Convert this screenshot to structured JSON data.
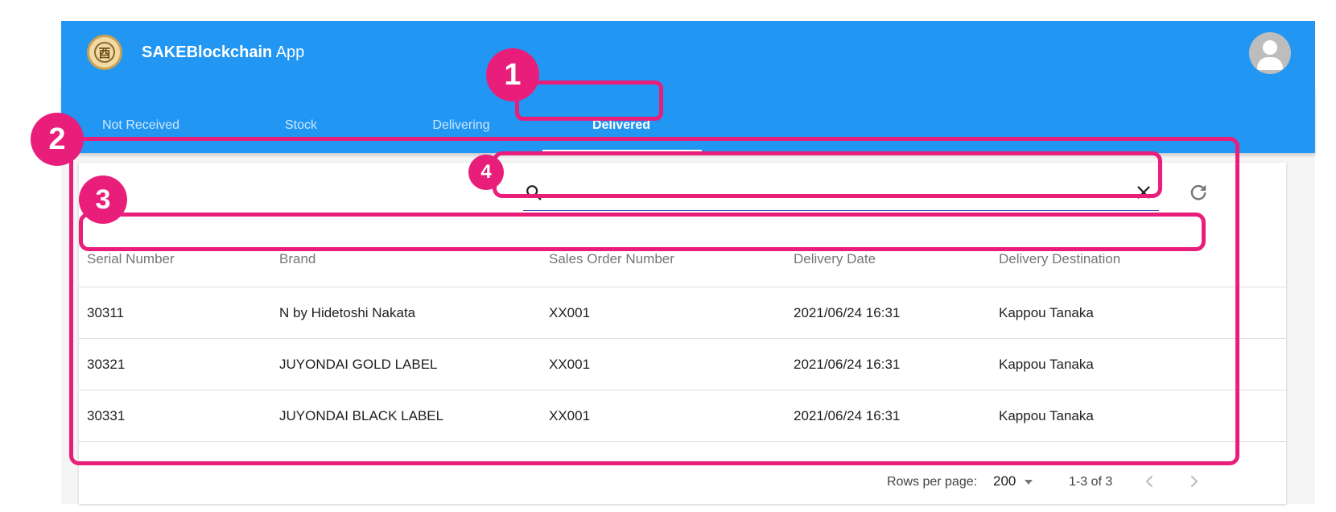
{
  "app": {
    "title_bold": "SAKEBlockchain",
    "title_rest": " App",
    "logo_glyph": "酉"
  },
  "tabs": [
    {
      "label": "Not Received"
    },
    {
      "label": "Stock"
    },
    {
      "label": "Delivering"
    },
    {
      "label": "Delivered",
      "active": true
    }
  ],
  "search": {
    "value": "",
    "placeholder": ""
  },
  "table": {
    "columns": [
      "Serial Number",
      "Brand",
      "Sales Order Number",
      "Delivery Date",
      "Delivery Destination"
    ],
    "rows": [
      [
        "30311",
        "N by Hidetoshi Nakata",
        "XX001",
        "2021/06/24 16:31",
        "Kappou Tanaka"
      ],
      [
        "30321",
        "JUYONDAI GOLD LABEL",
        "XX001",
        "2021/06/24 16:31",
        "Kappou Tanaka"
      ],
      [
        "30331",
        "JUYONDAI BLACK LABEL",
        "XX001",
        "2021/06/24 16:31",
        "Kappou Tanaka"
      ]
    ]
  },
  "pagination": {
    "rows_per_page_label": "Rows per page:",
    "rows_per_page_value": "200",
    "range_text": "1-3 of 3"
  },
  "annotations": {
    "badge_1": "1",
    "badge_2": "2",
    "badge_3": "3",
    "badge_4": "4"
  },
  "colors": {
    "primary": "#2196f3",
    "annotation": "#e91e7a",
    "search_underline": "#3f51b5"
  },
  "icons": {
    "search": "search-icon",
    "clear": "close-icon",
    "refresh": "refresh-icon",
    "account": "account-circle-icon",
    "prev": "chevron-left-icon",
    "next": "chevron-right-icon",
    "dropdown": "caret-down-icon"
  }
}
